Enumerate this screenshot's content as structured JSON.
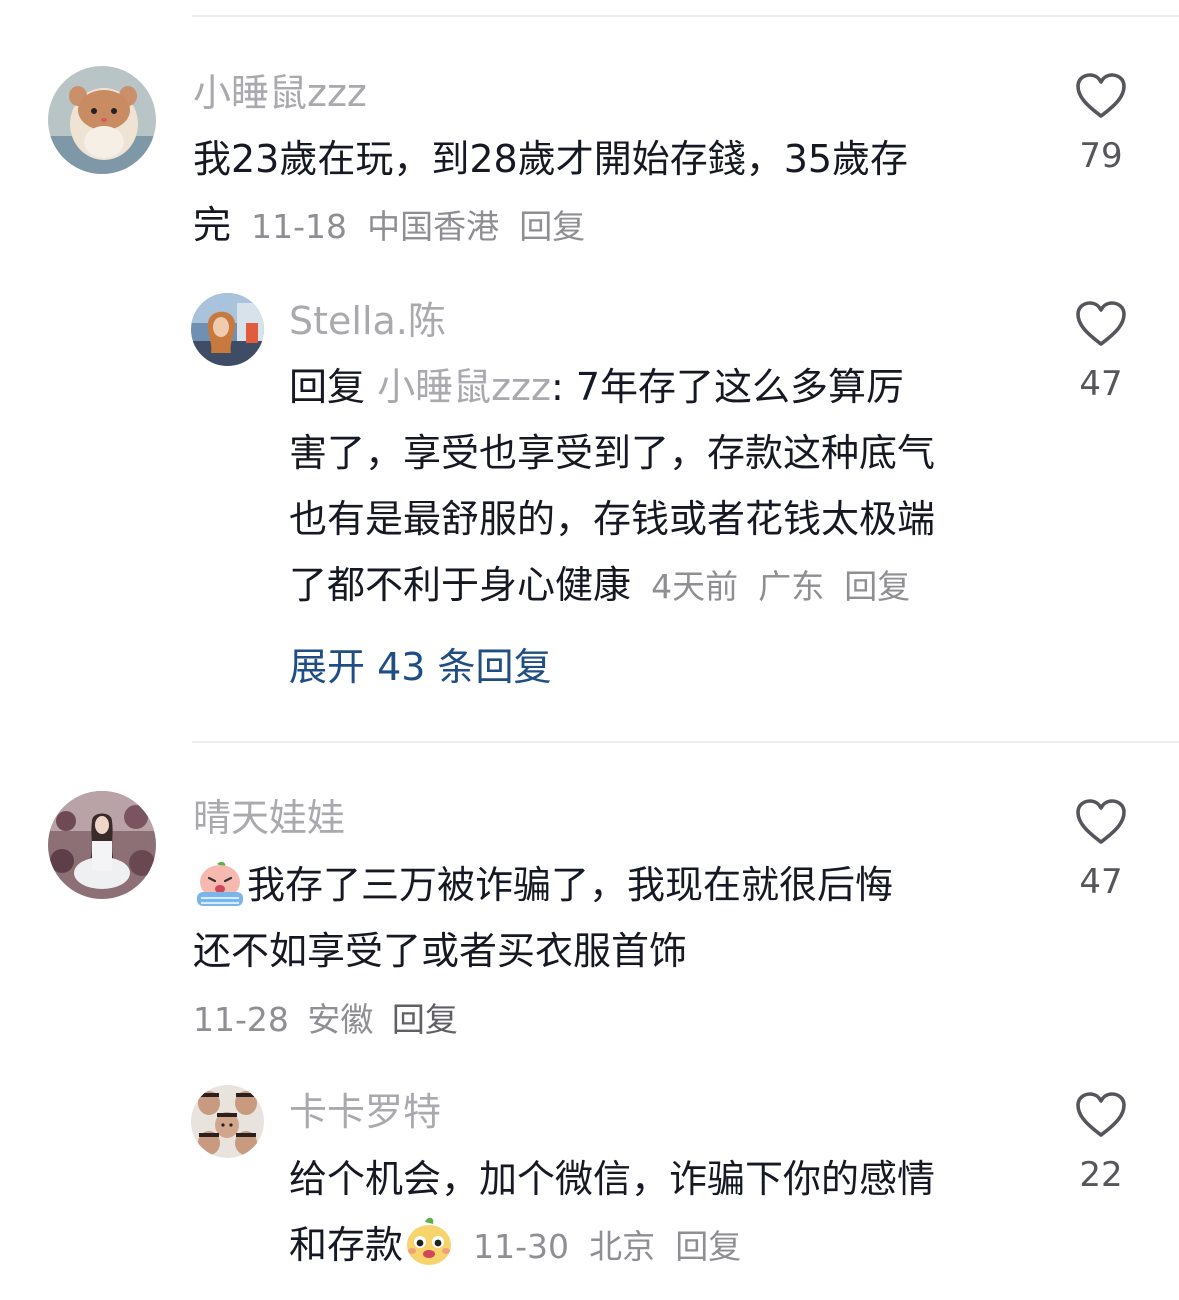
{
  "comments": [
    {
      "username": "小睡鼠zzz",
      "line1": "我23歲在玩，到28歲才開始存錢，35歲存",
      "line2": "完",
      "date": "11-18",
      "location": "中国香港",
      "reply_label": "回复",
      "likes": "79",
      "replies": [
        {
          "username": "Stella.陈",
          "reply_prefix": "回复",
          "reply_to": "小睡鼠zzz",
          "line1": ": 7年存了这么多算厉",
          "line2": "害了，享受也享受到了，存款这种底气",
          "line3": "也有是最舒服的，存钱或者花钱太极端",
          "line4": "了都不利于身心健康",
          "date": "4天前",
          "location": "广东",
          "reply_label": "回复",
          "likes": "47"
        }
      ],
      "expand_label": "展开 43 条回复"
    },
    {
      "username": "晴天娃娃",
      "emoji": "crying-face-emoji",
      "line1": "我存了三万被诈骗了，我现在就很后悔",
      "line2": "还不如享受了或者买衣服首饰",
      "date": "11-28",
      "location": "安徽",
      "reply_label": "回复",
      "likes": "47",
      "replies": [
        {
          "username": "卡卡罗特",
          "line1": "给个机会，加个微信，诈骗下你的感情",
          "line2": "和存款",
          "emoji": "cute-face-emoji",
          "date": "11-30",
          "location": "北京",
          "reply_label": "回复",
          "likes": "22"
        }
      ]
    }
  ],
  "colors": {
    "text": "#161823",
    "username": "#a9a9ae",
    "meta": "#8e8e93",
    "expand_link": "#1f4e84",
    "divider": "#ececec"
  }
}
